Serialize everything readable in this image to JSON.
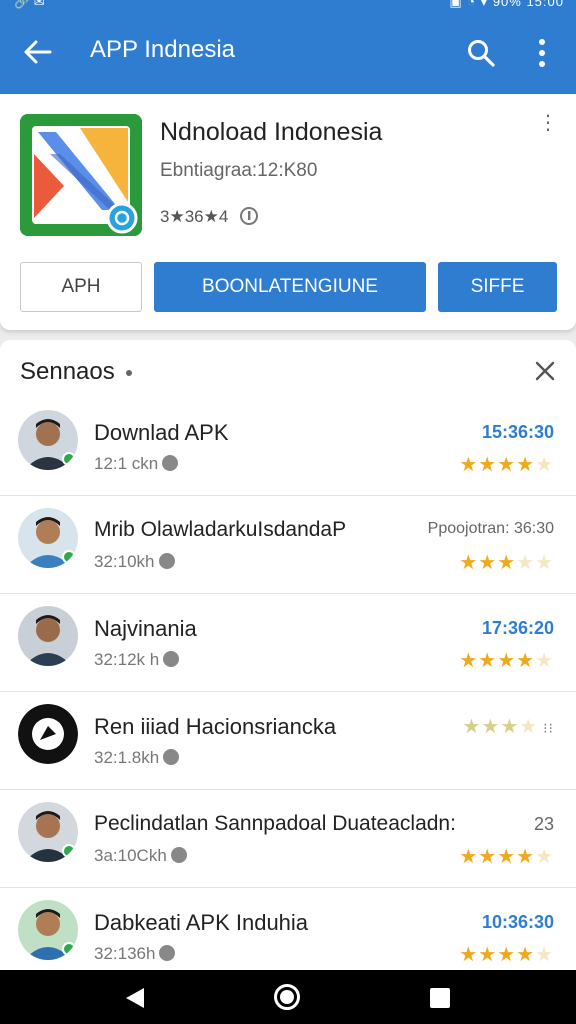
{
  "status_bar": {
    "left": "🔗 ✉",
    "right": "▣ ◔ ▾ 90% 15:00"
  },
  "app_bar": {
    "title": "APP Indnesia",
    "back_icon": "arrow-left-icon",
    "search_icon": "search-icon",
    "more_icon": "more-vert-icon"
  },
  "app_card": {
    "name": "Ndnoload Indonesia",
    "subtitle": "Ebntiagraa:12:K80",
    "rating_text": "3★36★4",
    "buttons": {
      "apk": "APH",
      "download": "BOONLATENGIUNE",
      "share": "SIFFE"
    }
  },
  "list": {
    "title": "Sennaos",
    "items": [
      {
        "title": "Downlad APK",
        "sub": "12:1 ckn",
        "time": "15:36:30",
        "meta": "",
        "stars": [
          1,
          1,
          1,
          0.5,
          0
        ]
      },
      {
        "title": "Mrib OlawladarkuIsdandaP",
        "sub": "32:10kh",
        "time": "",
        "meta": "Ppoojotran: 36:30",
        "stars": [
          1,
          1,
          0.5,
          0,
          0
        ]
      },
      {
        "title": "Najvinania",
        "sub": "32:12k h",
        "time": "17:36:20",
        "meta": "",
        "stars": [
          1,
          1,
          1,
          0.5,
          0
        ]
      },
      {
        "title": "Ren iiiad Hacionsriancka",
        "sub": "32:1.8kh",
        "time": "",
        "meta": "",
        "stars": [
          1,
          1,
          1,
          0,
          0
        ]
      },
      {
        "title": "Peclindatlan Sannpadoal Duateacladn:",
        "sub": "3a:10Ckh",
        "time": "",
        "meta": "23",
        "stars": [
          1,
          1,
          1,
          0.5,
          0
        ]
      },
      {
        "title": "Dabkeati APK Induhia",
        "sub": "32:136h",
        "time": "10:36:30",
        "meta": "",
        "stars": [
          1,
          1,
          0.5,
          0.5,
          0
        ]
      }
    ]
  },
  "colors": {
    "primary": "#2f7dd1",
    "star": "#f1a91c",
    "badge": "#2eaa4a"
  }
}
